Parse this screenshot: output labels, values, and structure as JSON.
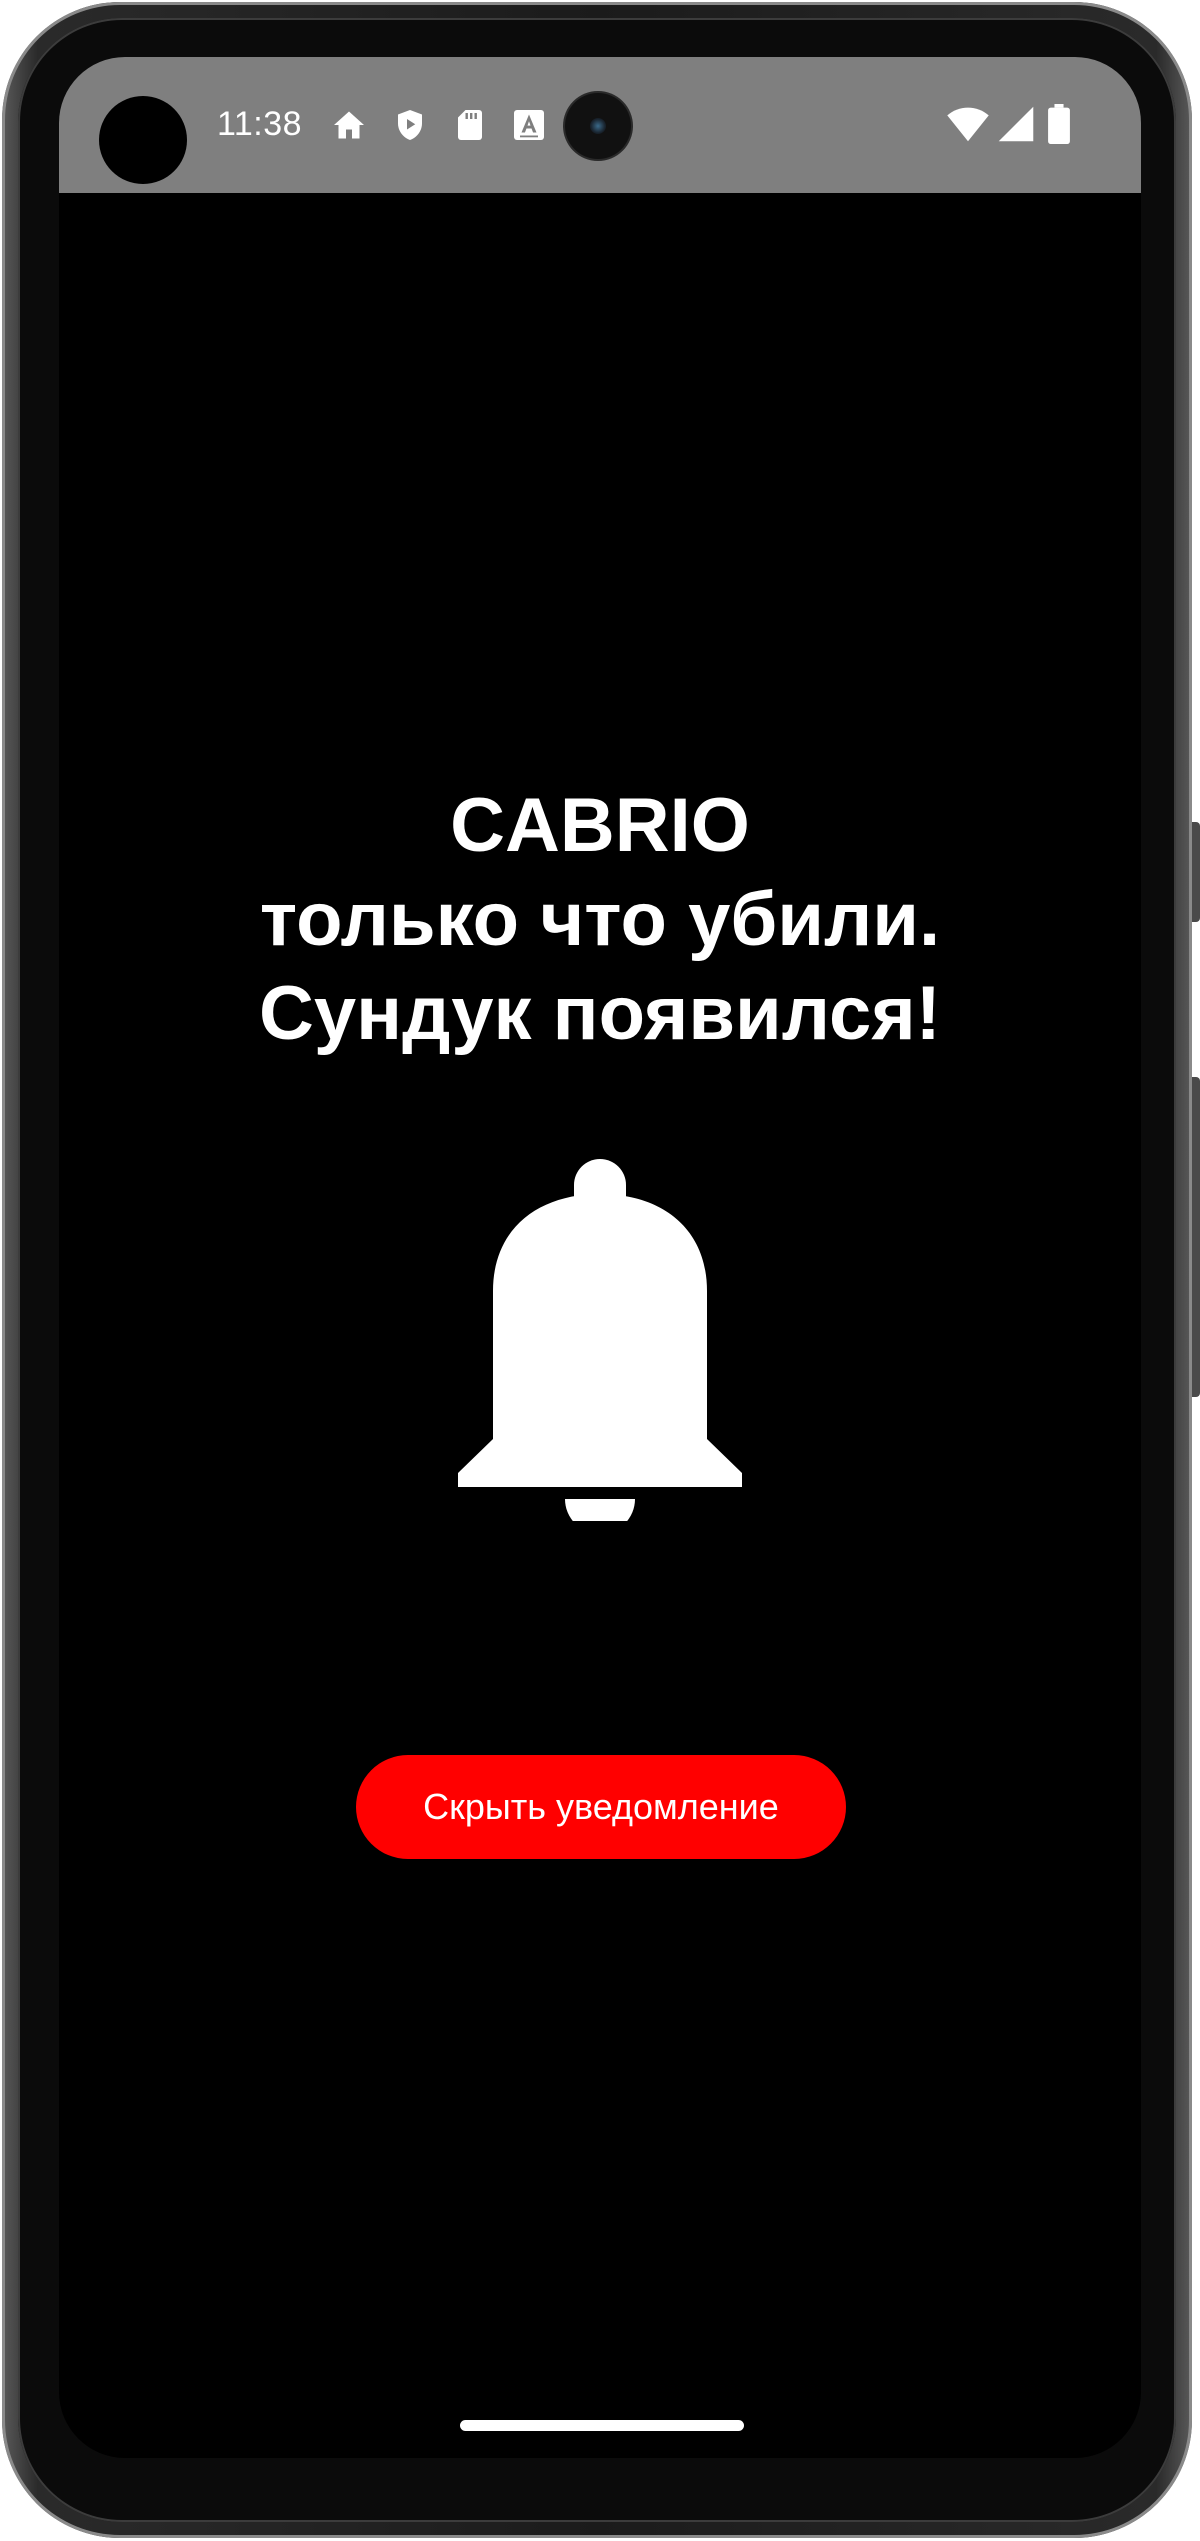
{
  "status_bar": {
    "time": "11:38",
    "background_color": "#7f7f7f",
    "notification_icons": [
      "home-icon",
      "shield-icon",
      "sd-card-icon",
      "font-a-icon"
    ],
    "system_icons": [
      "wifi-icon",
      "cellular-signal-icon",
      "battery-icon"
    ]
  },
  "notification": {
    "line1": "CABRIO",
    "line2": "только что убили.",
    "line3": "Сундук появился!",
    "icon": "bell-icon",
    "hide_button_label": "Скрыть уведомление",
    "button_color": "#ff0000",
    "background_color": "#000000"
  },
  "navigation": {
    "gesture_bar": "home-indicator"
  }
}
